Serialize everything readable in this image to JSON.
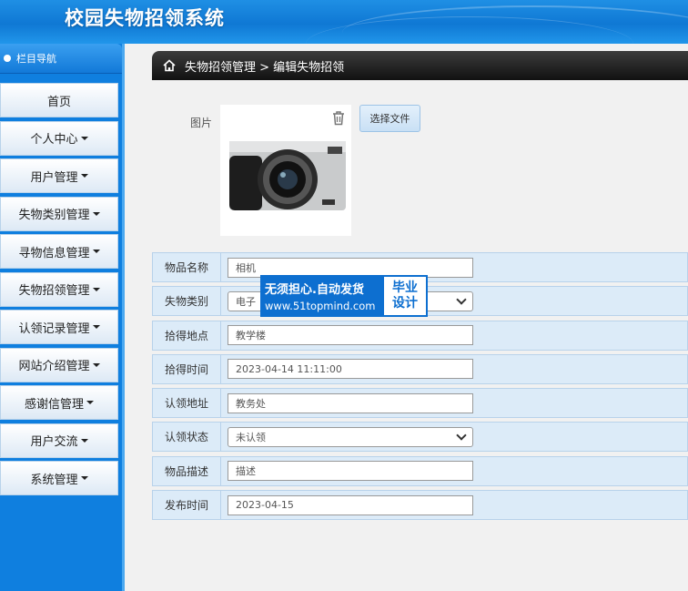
{
  "header": {
    "title": "校园失物招领系统"
  },
  "sidebar": {
    "heading": "栏目导航",
    "items": [
      {
        "label": "首页",
        "has_caret": false
      },
      {
        "label": "个人中心",
        "has_caret": true
      },
      {
        "label": "用户管理",
        "has_caret": true
      },
      {
        "label": "失物类别管理",
        "has_caret": true
      },
      {
        "label": "寻物信息管理",
        "has_caret": true
      },
      {
        "label": "失物招领管理",
        "has_caret": true
      },
      {
        "label": "认领记录管理",
        "has_caret": true
      },
      {
        "label": "网站介绍管理",
        "has_caret": true
      },
      {
        "label": "感谢信管理",
        "has_caret": true
      },
      {
        "label": "用户交流",
        "has_caret": true
      },
      {
        "label": "系统管理",
        "has_caret": true
      }
    ]
  },
  "breadcrumb": {
    "text": "失物招领管理 > 编辑失物招领"
  },
  "image_section": {
    "label": "图片",
    "choose_file": "选择文件"
  },
  "form": {
    "rows": [
      {
        "label": "物品名称",
        "value": "相机",
        "type": "text"
      },
      {
        "label": "失物类别",
        "value": "电子",
        "type": "select"
      },
      {
        "label": "拾得地点",
        "value": "教学楼",
        "type": "text"
      },
      {
        "label": "拾得时间",
        "value": "2023-04-14 11:11:00",
        "type": "text"
      },
      {
        "label": "认领地址",
        "value": "教务处",
        "type": "text"
      },
      {
        "label": "认领状态",
        "value": "未认领",
        "type": "select"
      },
      {
        "label": "物品描述",
        "value": "描述",
        "type": "text"
      },
      {
        "label": "发布时间",
        "value": "2023-04-15",
        "type": "text"
      }
    ]
  },
  "watermark": {
    "line1": "无须担心.自动发货",
    "line2": "www.51topmind.com",
    "badge1": "毕业",
    "badge2": "设计"
  },
  "colors": {
    "header_blue": "#0f78d4",
    "sidebar_blue": "#0f7fdf",
    "row_bg": "#dcebf8",
    "breadcrumb_dark": "#111111"
  }
}
